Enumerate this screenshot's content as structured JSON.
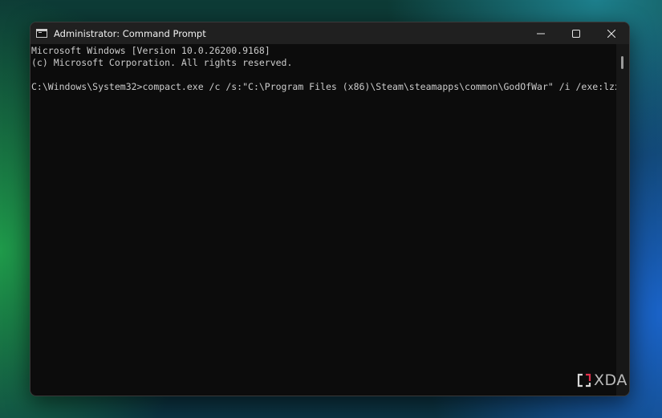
{
  "window": {
    "title": "Administrator: Command Prompt",
    "app_icon": "cmd-icon",
    "controls": {
      "minimize": "minimize-icon",
      "maximize": "maximize-icon",
      "close": "close-icon"
    }
  },
  "console": {
    "lines": [
      "Microsoft Windows [Version 10.0.26200.9168]",
      "(c) Microsoft Corporation. All rights reserved.",
      "",
      "C:\\Windows\\System32>compact.exe /c /s:\"C:\\Program Files (x86)\\Steam\\steamapps\\common\\GodOfWar\" /i /exe:lzx"
    ]
  },
  "watermark": {
    "text": "XDA",
    "accent_color": "#e0304a"
  },
  "colors": {
    "console_bg": "#0c0c0c",
    "console_text": "#cccccc",
    "titlebar_bg": "#202020"
  }
}
